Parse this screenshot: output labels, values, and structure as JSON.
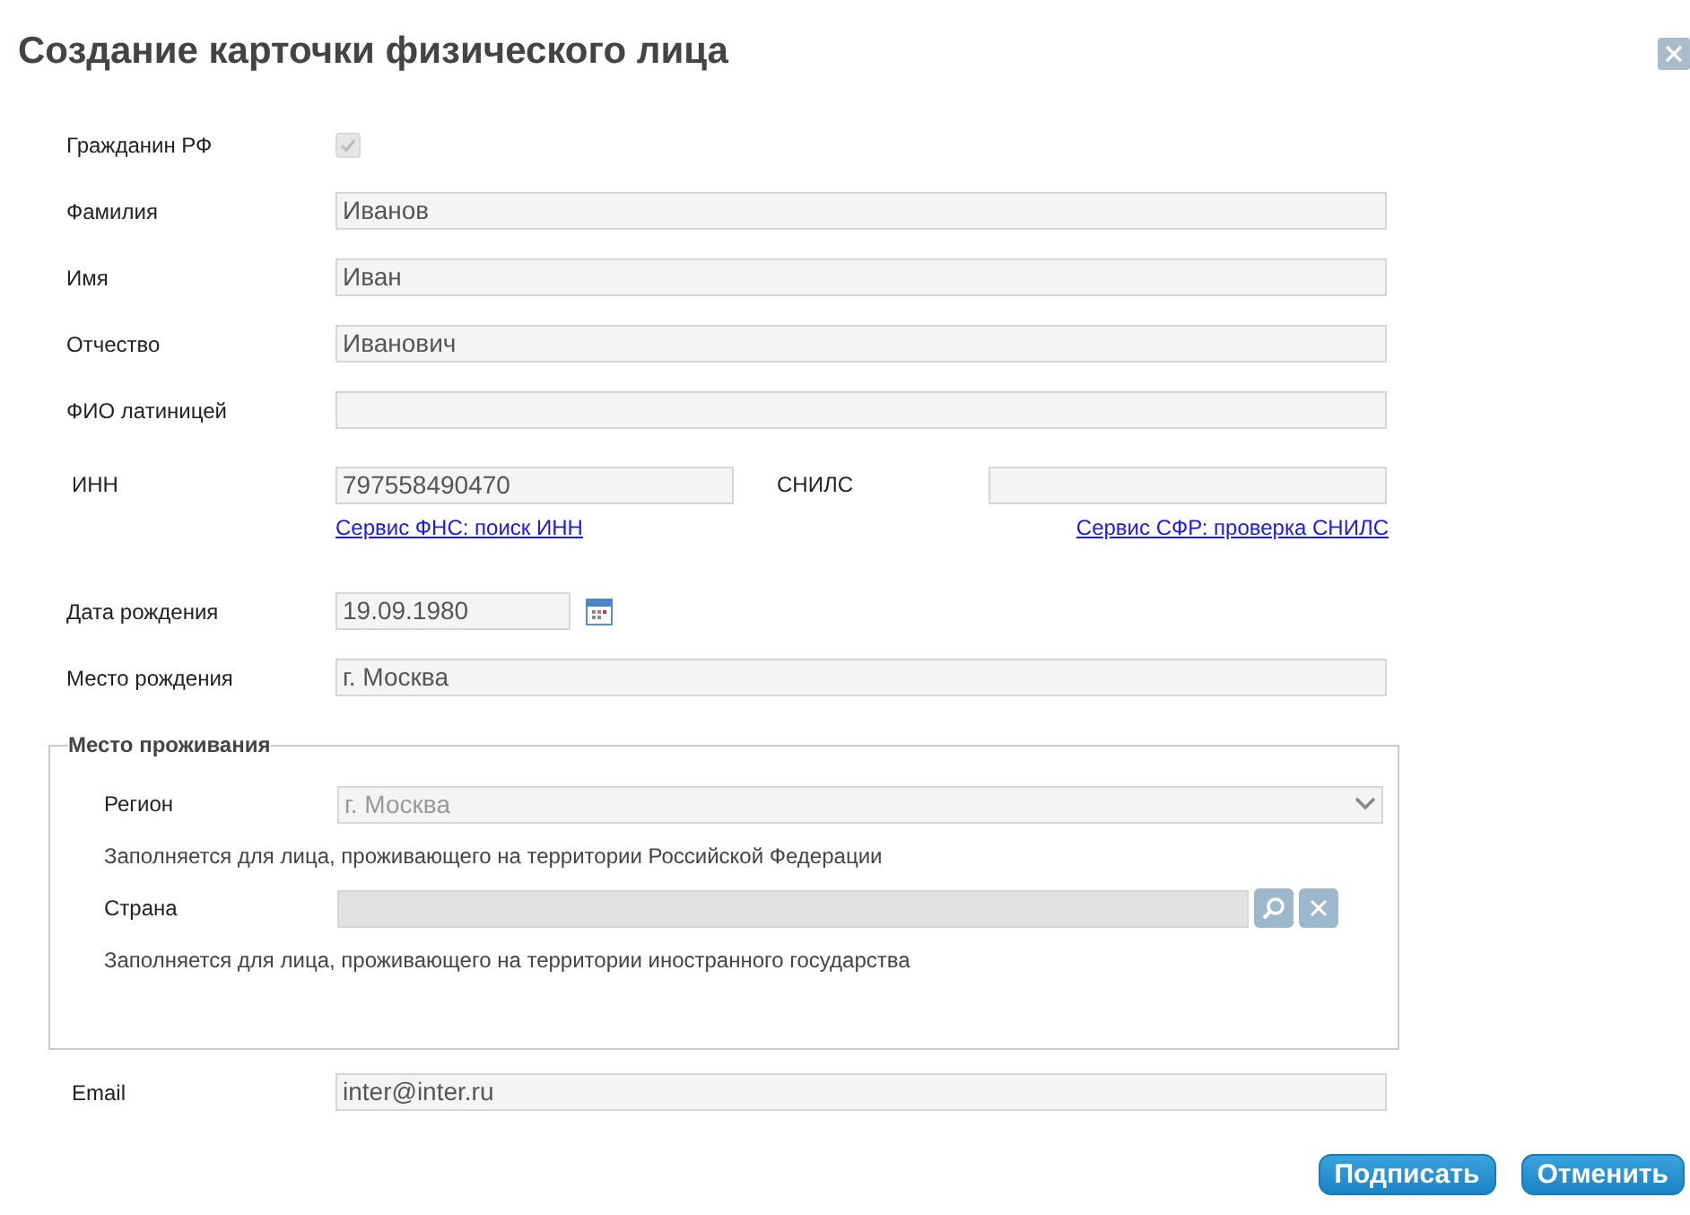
{
  "dialog": {
    "title": "Создание карточки физического лица"
  },
  "fields": [
    {
      "kind": "checkbox",
      "label": "Гражданин РФ",
      "checked": true,
      "disabled": true
    },
    {
      "kind": "text",
      "label": "Фамилия",
      "value": "Иванов"
    },
    {
      "kind": "text",
      "label": "Имя",
      "value": "Иван"
    },
    {
      "kind": "text",
      "label": "Отчество",
      "value": "Иванович"
    },
    {
      "kind": "text",
      "label": "ФИО латиницей"
    }
  ],
  "tax_ids": [
    {
      "label": "ИНН",
      "value": "797558490470",
      "link": "Сервис ФНС: поиск ИНН"
    },
    {
      "label": "СНИЛС",
      "link": "Сервис СФР: проверка СНИЛС"
    }
  ],
  "birth": [
    {
      "kind": "date",
      "label": "Дата рождения",
      "value": "19.09.1980"
    },
    {
      "kind": "text",
      "label": "Место рождения",
      "value": "г. Москва"
    }
  ],
  "residence": {
    "legend": "Место проживания",
    "rows": [
      {
        "kind": "select",
        "label": "Регион",
        "value": "г. Москва",
        "disabled": true,
        "hint": "Заполняется для лица, проживающего на территории Российской Федерации"
      },
      {
        "kind": "lookup",
        "label": "Страна",
        "disabled": true,
        "hint": "Заполняется для лица, проживающего на территории иностранного государства"
      }
    ]
  },
  "email": {
    "label": "Email",
    "value": "inter@inter.ru"
  },
  "buttons": [
    "Подписать",
    "Отменить"
  ]
}
